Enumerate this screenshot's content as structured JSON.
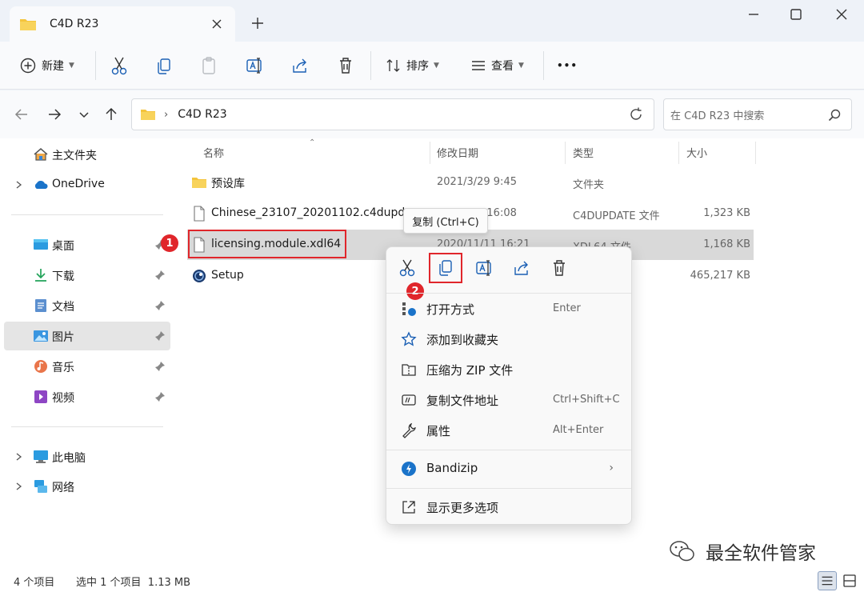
{
  "window": {
    "tab_title": "C4D R23"
  },
  "toolbar": {
    "new_label": "新建",
    "sort_label": "排序",
    "view_label": "查看",
    "more_label": "•••"
  },
  "address": {
    "path": "C4D R23",
    "search_placeholder": "在 C4D R23 中搜索"
  },
  "sidebar": {
    "items": [
      {
        "label": "主文件夹",
        "icon": "home-icon"
      },
      {
        "label": "OneDrive",
        "icon": "cloud-icon"
      },
      {
        "label": "桌面",
        "icon": "desktop-icon"
      },
      {
        "label": "下载",
        "icon": "download-icon"
      },
      {
        "label": "文档",
        "icon": "document-icon"
      },
      {
        "label": "图片",
        "icon": "pictures-icon"
      },
      {
        "label": "音乐",
        "icon": "music-icon"
      },
      {
        "label": "视频",
        "icon": "video-icon"
      },
      {
        "label": "此电脑",
        "icon": "computer-icon"
      },
      {
        "label": "网络",
        "icon": "network-icon"
      }
    ]
  },
  "columns": {
    "name": "名称",
    "date": "修改日期",
    "type": "类型",
    "size": "大小"
  },
  "files": [
    {
      "name": "预设库",
      "date": "2021/3/29 9:45",
      "type": "文件夹",
      "size": ""
    },
    {
      "name": "Chinese_23107_20201102.c4dupda",
      "date": "9 16:08",
      "type": "C4DUPDATE 文件",
      "size": "1,323 KB"
    },
    {
      "name": "licensing.module.xdl64",
      "date": "2020/11/11 16:21",
      "type": "XDL64 文件",
      "size": "1,168 KB"
    },
    {
      "name": "Setup",
      "date": "",
      "type": "",
      "size": "465,217 KB"
    }
  ],
  "tooltip": "复制 (Ctrl+C)",
  "badges": {
    "one": "1",
    "two": "2"
  },
  "context_menu": {
    "items": [
      {
        "label": "打开方式",
        "accel": "Enter"
      },
      {
        "label": "添加到收藏夹",
        "accel": ""
      },
      {
        "label": "压缩为 ZIP 文件",
        "accel": ""
      },
      {
        "label": "复制文件地址",
        "accel": "Ctrl+Shift+C"
      },
      {
        "label": "属性",
        "accel": "Alt+Enter"
      },
      {
        "label": "Bandizip",
        "accel": ""
      },
      {
        "label": "显示更多选项",
        "accel": ""
      }
    ]
  },
  "status": {
    "count": "4 个项目",
    "selection": "选中 1 个项目  1.13 MB"
  },
  "watermark": "最全软件管家",
  "colors": {
    "accent_red": "#e0262b",
    "folder_yellow": "#f4c43c",
    "blue": "#1a73c9"
  }
}
